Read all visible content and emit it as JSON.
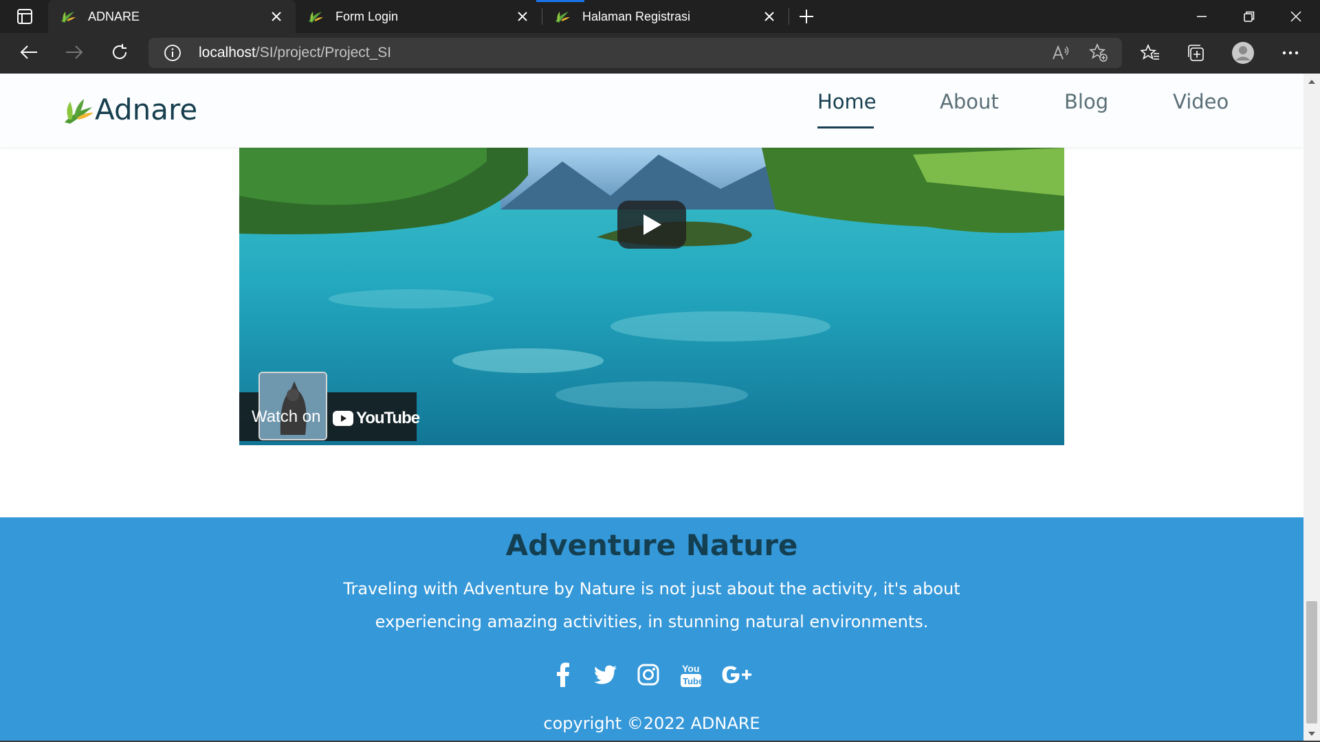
{
  "browser": {
    "tabs": [
      {
        "title": "ADNARE",
        "active": true
      },
      {
        "title": "Form Login",
        "active": false
      },
      {
        "title": "Halaman Registrasi",
        "active": false
      }
    ],
    "url_host": "localhost",
    "url_path": "/SI/project/Project_SI",
    "icons": [
      "tab-actions-icon",
      "close-icon",
      "new-tab-icon",
      "minimize-icon",
      "restore-icon",
      "window-close-icon",
      "back-icon",
      "forward-icon",
      "refresh-icon",
      "info-icon",
      "read-aloud-icon",
      "add-favorite-icon",
      "favorites-icon",
      "collections-icon",
      "profile-icon",
      "more-icon"
    ]
  },
  "site": {
    "logo_text": "Adnare",
    "nav": [
      {
        "label": "Home",
        "active": true
      },
      {
        "label": "About",
        "active": false
      },
      {
        "label": "Blog",
        "active": false
      },
      {
        "label": "Video",
        "active": false
      }
    ]
  },
  "video": {
    "watch_on": "Watch on",
    "platform": "YouTube"
  },
  "footer": {
    "title": "Adventure Nature",
    "description": "Traveling with Adventure by Nature is not just about the activity, it's about experiencing amazing activities, in stunning natural environments.",
    "socials": [
      "facebook-icon",
      "twitter-icon",
      "instagram-icon",
      "youtube-icon",
      "google-plus-icon"
    ],
    "copyright": "copyright ©2022 ADNARE"
  },
  "colors": {
    "footer_bg": "#3598d9",
    "brand_dark": "#173f4f",
    "chrome_dark": "#202020"
  }
}
